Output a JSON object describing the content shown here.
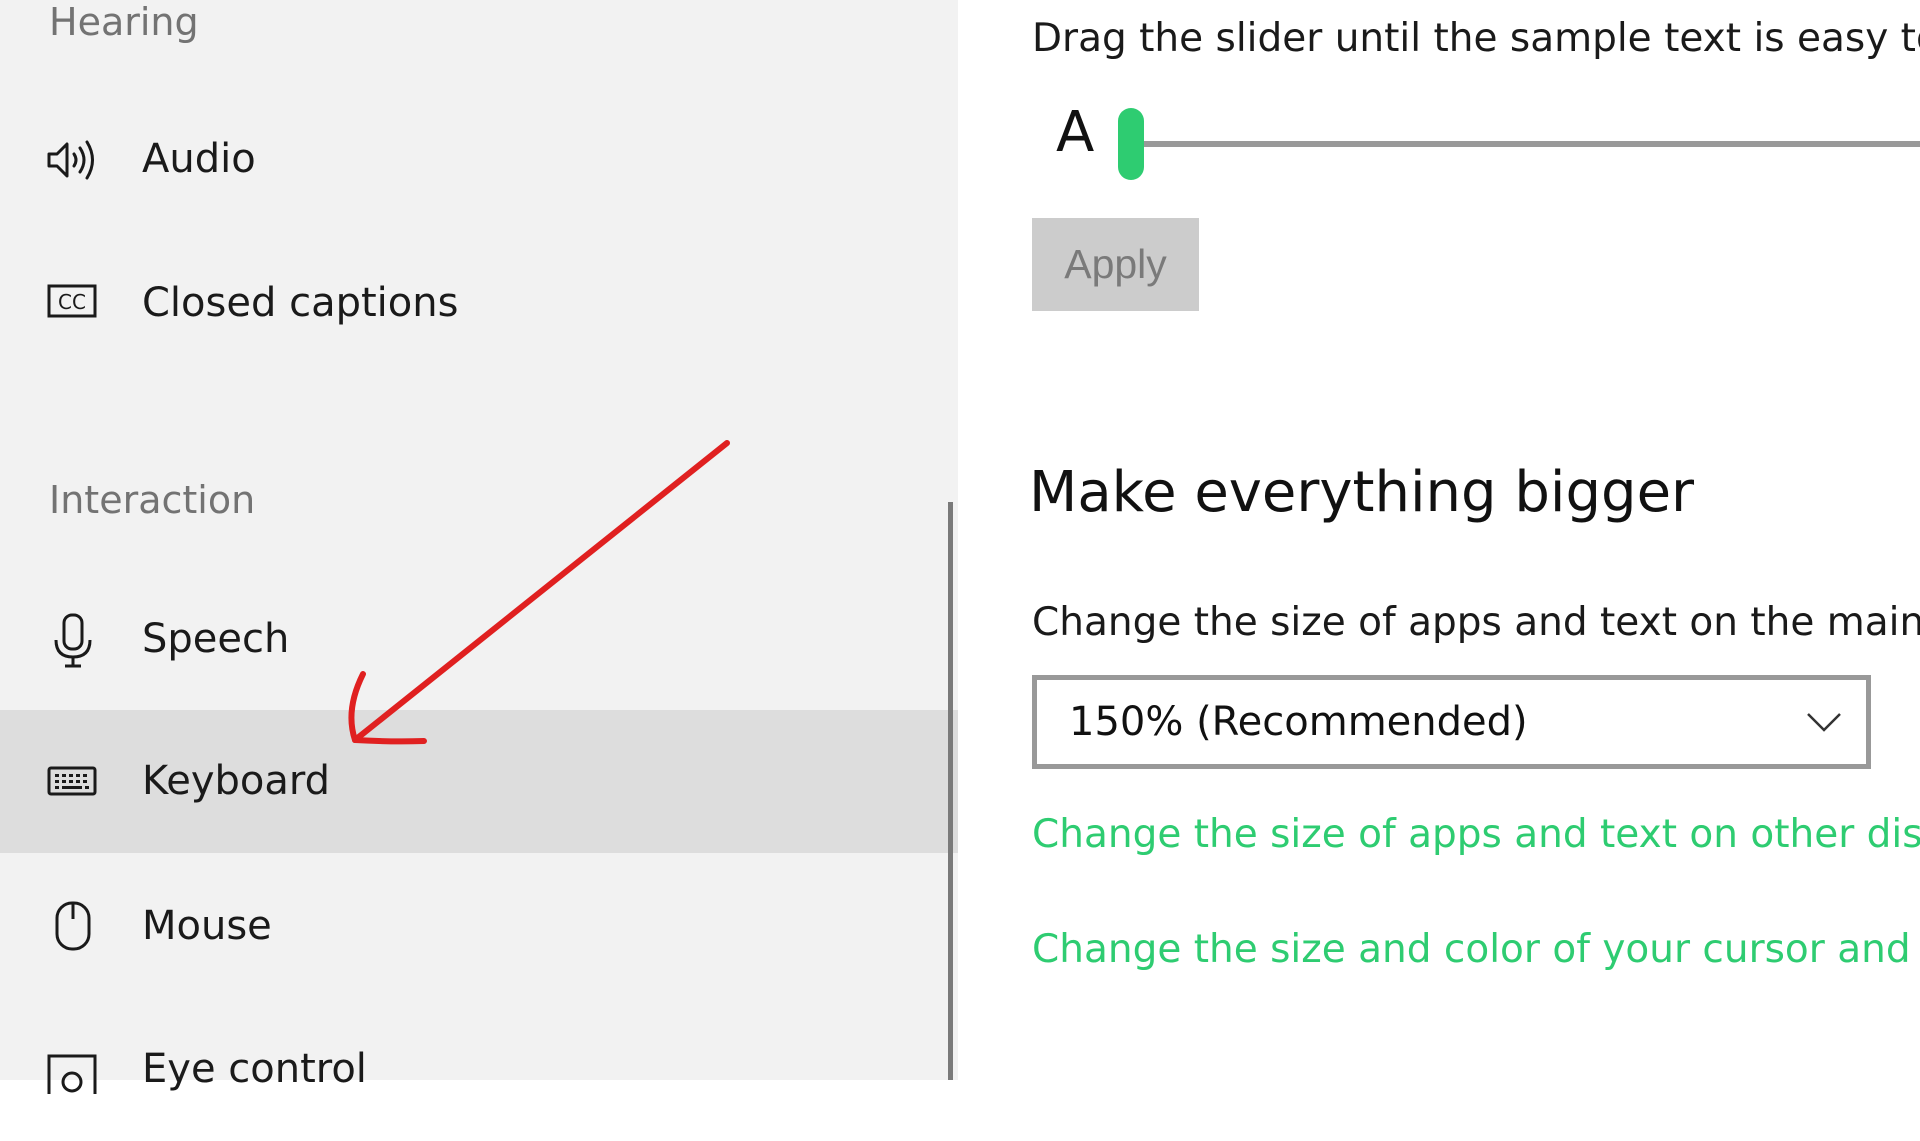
{
  "sidebar": {
    "sections": [
      {
        "label": "Hearing"
      },
      {
        "label": "Interaction"
      }
    ],
    "items": [
      {
        "label": "Audio",
        "icon": "speaker-icon"
      },
      {
        "label": "Closed captions",
        "icon": "closed-captions-icon"
      },
      {
        "label": "Speech",
        "icon": "microphone-icon"
      },
      {
        "label": "Keyboard",
        "icon": "keyboard-icon",
        "selected": true
      },
      {
        "label": "Mouse",
        "icon": "mouse-icon"
      },
      {
        "label": "Eye control",
        "icon": "eye-control-icon"
      }
    ]
  },
  "main": {
    "text_size": {
      "description": "Drag the slider until the sample text is easy to re",
      "sample_label": "A",
      "slider_value_fraction": 0.0,
      "apply_label": "Apply"
    },
    "make_bigger": {
      "heading": "Make everything bigger",
      "description": "Change the size of apps and text on the main di",
      "dropdown_value": "150% (Recommended)",
      "links": [
        "Change the size of apps and text on other displa",
        "Change the size and color of your cursor and mo"
      ]
    }
  },
  "colors": {
    "accent": "#2ecc71",
    "link": "#2ecc71",
    "annotation_arrow": "#e02020",
    "selected_bg": "#dddddd"
  },
  "annotation": {
    "type": "arrow",
    "points_to": "Keyboard"
  }
}
